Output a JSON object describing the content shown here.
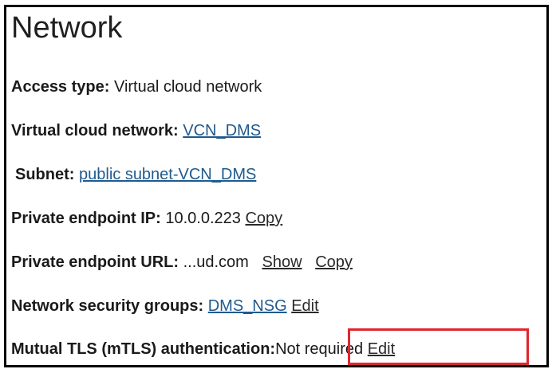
{
  "section": {
    "title": "Network"
  },
  "fields": {
    "access_type": {
      "label": "Access type:",
      "value": "Virtual cloud network"
    },
    "vcn": {
      "label": "Virtual cloud network:",
      "link": "VCN_DMS"
    },
    "subnet": {
      "label": "Subnet:",
      "link": "public subnet-VCN_DMS"
    },
    "private_ip": {
      "label": "Private endpoint IP:",
      "value": "10.0.0.223",
      "copy_label": "Copy"
    },
    "private_url": {
      "label": "Private endpoint URL:",
      "value": "...ud.com",
      "show_label": "Show",
      "copy_label": "Copy"
    },
    "nsg": {
      "label": "Network security groups:",
      "link": "DMS_NSG",
      "edit_label": "Edit"
    },
    "mtls": {
      "label": "Mutual TLS (mTLS) authentication:",
      "value": "Not required",
      "edit_label": "Edit"
    }
  },
  "colors": {
    "link": "#1f5a8f",
    "highlight": "#e0262d",
    "frame": "#000000"
  }
}
